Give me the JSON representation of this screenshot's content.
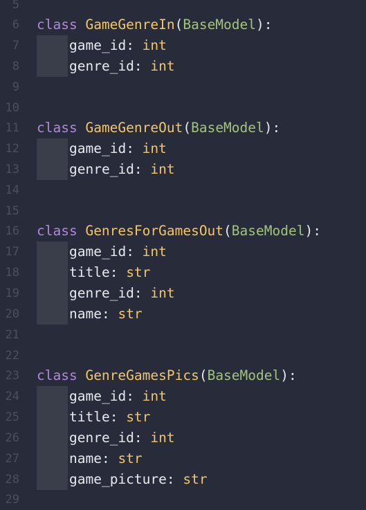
{
  "editor": {
    "colors": {
      "background": "#272b3a",
      "line_number": "#4a5060",
      "keyword": "#b08ad8",
      "class_name": "#f3c668",
      "base_class": "#a3c47a",
      "type": "#f3c668",
      "identifier": "#e8eaf0",
      "indent_guide": "#3a3e4a"
    },
    "lines": [
      {
        "n": "5"
      },
      {
        "n": "6",
        "kw": "class",
        "cls": "GameGenreIn",
        "base": "BaseModel"
      },
      {
        "n": "7",
        "name": "game_id",
        "type": "int"
      },
      {
        "n": "8",
        "name": "genre_id",
        "type": "int"
      },
      {
        "n": "9"
      },
      {
        "n": "10"
      },
      {
        "n": "11",
        "kw": "class",
        "cls": "GameGenreOut",
        "base": "BaseModel"
      },
      {
        "n": "12",
        "name": "game_id",
        "type": "int"
      },
      {
        "n": "13",
        "name": "genre_id",
        "type": "int"
      },
      {
        "n": "14"
      },
      {
        "n": "15"
      },
      {
        "n": "16",
        "kw": "class",
        "cls": "GenresForGamesOut",
        "base": "BaseModel"
      },
      {
        "n": "17",
        "name": "game_id",
        "type": "int"
      },
      {
        "n": "18",
        "name": "title",
        "type": "str"
      },
      {
        "n": "19",
        "name": "genre_id",
        "type": "int"
      },
      {
        "n": "20",
        "name": "name",
        "type": "str"
      },
      {
        "n": "21"
      },
      {
        "n": "22"
      },
      {
        "n": "23",
        "kw": "class",
        "cls": "GenreGamesPics",
        "base": "BaseModel"
      },
      {
        "n": "24",
        "name": "game_id",
        "type": "int"
      },
      {
        "n": "25",
        "name": "title",
        "type": "str"
      },
      {
        "n": "26",
        "name": "genre_id",
        "type": "int"
      },
      {
        "n": "27",
        "name": "name",
        "type": "str"
      },
      {
        "n": "28",
        "name": "game_picture",
        "type": "str"
      },
      {
        "n": "29"
      }
    ]
  }
}
